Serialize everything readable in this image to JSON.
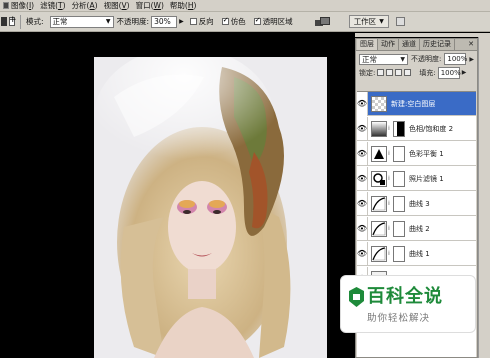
{
  "menubar": {
    "items": [
      {
        "label": "图像(",
        "key": "I",
        "suffix": ")"
      },
      {
        "label": "滤镜(",
        "key": "T",
        "suffix": ")"
      },
      {
        "label": "分析(",
        "key": "A",
        "suffix": ")"
      },
      {
        "label": "视图(",
        "key": "V",
        "suffix": ")"
      },
      {
        "label": "窗口(",
        "key": "W",
        "suffix": ")"
      },
      {
        "label": "帮助(",
        "key": "H",
        "suffix": ")"
      }
    ]
  },
  "options": {
    "mode_label": "模式:",
    "mode_value": "正常",
    "opacity_label": "不透明度:",
    "opacity_value": "30%",
    "reverse_label": "反向",
    "dither_label": "仿色",
    "transparency_label": "透明区域",
    "reverse_checked": false,
    "dither_checked": true,
    "transparency_checked": true,
    "workspace_label": "工作区"
  },
  "layers_panel": {
    "tabs": [
      "图层",
      "动作",
      "通道",
      "历史记录"
    ],
    "active_tab": 0,
    "blend_mode": "正常",
    "opacity_label": "不透明度:",
    "opacity_value": "100%",
    "lock_label": "锁定:",
    "fill_label": "填充:",
    "fill_value": "100%",
    "layers": [
      {
        "name": "新建:空白图层",
        "selected": true
      },
      {
        "name": "色相/饱和度 2",
        "selected": false
      },
      {
        "name": "色彩平衡 1",
        "selected": false
      },
      {
        "name": "照片滤镜 1",
        "selected": false
      },
      {
        "name": "曲线 3",
        "selected": false
      },
      {
        "name": "曲线 2",
        "selected": false
      },
      {
        "name": "曲线 1",
        "selected": false
      }
    ]
  },
  "watermark": {
    "title": "百科全说",
    "subtitle": "助你轻松解决"
  },
  "colors": {
    "selection": "#3a6bc6",
    "watermark_green": "#1e8a3a"
  }
}
